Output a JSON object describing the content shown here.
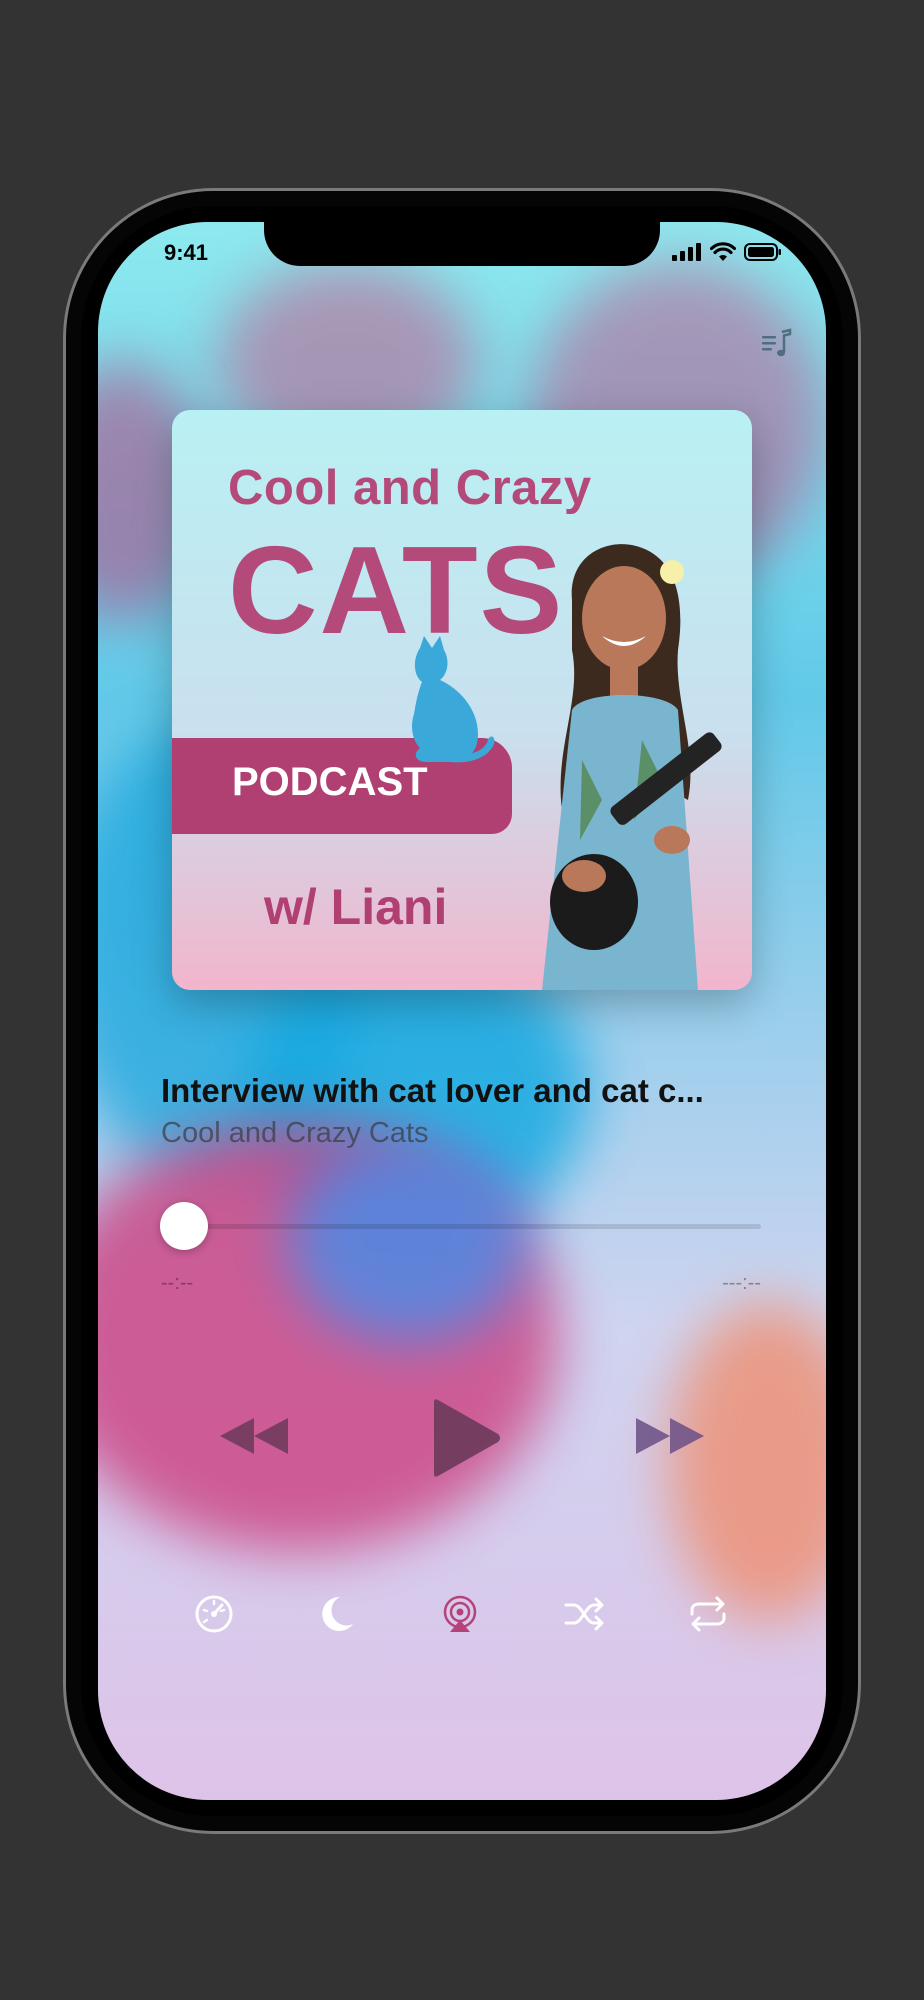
{
  "status_bar": {
    "time": "9:41"
  },
  "artwork": {
    "line1": "Cool and Crazy",
    "line2": "CATS",
    "line3": "PODCAST",
    "line4": "w/ Liani"
  },
  "track": {
    "title": "Interview with cat lover and cat c...",
    "show": "Cool and Crazy Cats"
  },
  "progress": {
    "elapsed": "--:--",
    "remaining": "---:--",
    "fraction": 0
  },
  "icons": {
    "queue": "queue-list-icon",
    "rewind": "rewind-icon",
    "play": "play-icon",
    "fast_forward": "fast-forward-icon",
    "speed": "playback-speed-icon",
    "sleep": "sleep-timer-moon-icon",
    "airplay": "airplay-icon",
    "shuffle": "shuffle-icon",
    "repeat": "repeat-icon"
  }
}
